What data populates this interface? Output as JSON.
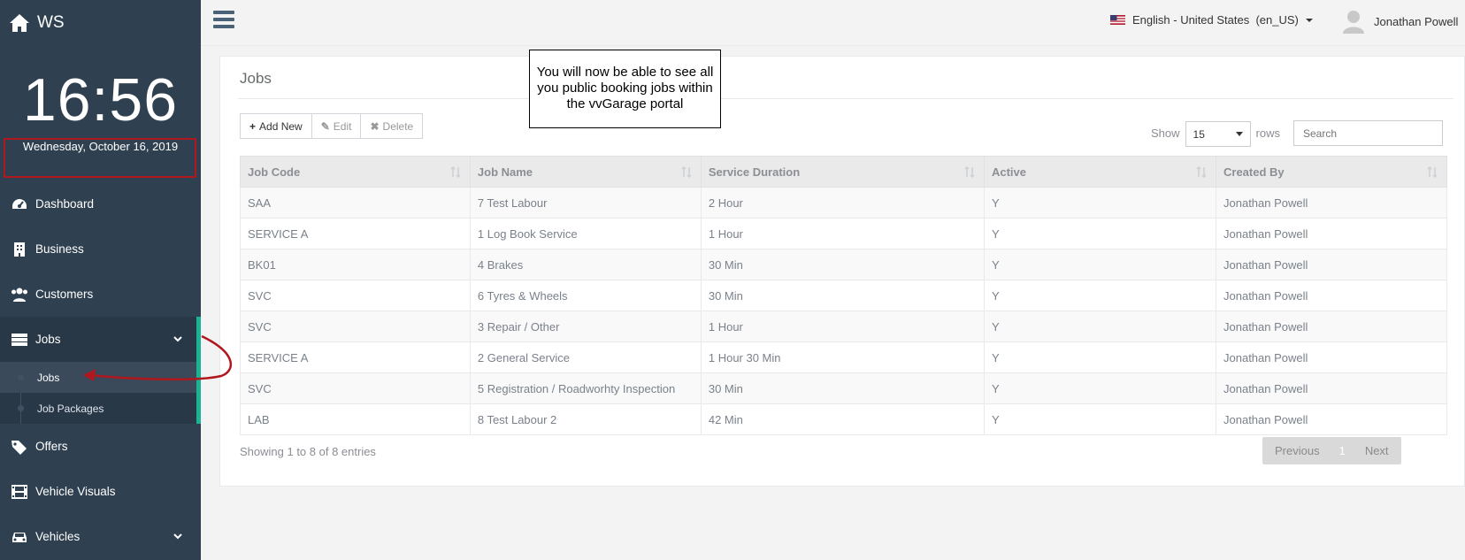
{
  "sidebar": {
    "brand": "WS",
    "clock": "16:56",
    "date": "Wednesday, October 16, 2019",
    "nav": {
      "dashboard": "Dashboard",
      "business": "Business",
      "customers": "Customers",
      "jobs": "Jobs",
      "jobs_sub": [
        "Jobs",
        "Job Packages"
      ],
      "offers": "Offers",
      "vehicle_visuals": "Vehicle Visuals",
      "vehicles": "Vehicles"
    }
  },
  "topbar": {
    "language": "English - United States  (en_US)",
    "user": "Jonathan Powell"
  },
  "panel": {
    "title": "Jobs",
    "buttons": {
      "add": "Add New",
      "edit": "Edit",
      "delete": "Delete"
    },
    "show_label": "Show",
    "rows_value": "15",
    "rows_label": "rows",
    "search_placeholder": "Search",
    "columns": [
      "Job Code",
      "Job Name",
      "Service Duration",
      "Active",
      "Created By"
    ],
    "rows": [
      [
        "SAA",
        "7 Test Labour",
        "2 Hour",
        "Y",
        "Jonathan Powell"
      ],
      [
        "SERVICE A",
        "1 Log Book Service",
        "1 Hour",
        "Y",
        "Jonathan Powell"
      ],
      [
        "BK01",
        "4 Brakes",
        "30 Min",
        "Y",
        "Jonathan Powell"
      ],
      [
        "SVC",
        "6 Tyres & Wheels",
        "30 Min",
        "Y",
        "Jonathan Powell"
      ],
      [
        "SVC",
        "3 Repair / Other",
        "1 Hour",
        "Y",
        "Jonathan Powell"
      ],
      [
        "SERVICE A",
        "2 General Service",
        "1 Hour 30 Min",
        "Y",
        "Jonathan Powell"
      ],
      [
        "SVC",
        "5 Registration / Roadworhty Inspection",
        "30 Min",
        "Y",
        "Jonathan Powell"
      ],
      [
        "LAB",
        "8 Test Labour 2",
        "42 Min",
        "Y",
        "Jonathan Powell"
      ]
    ],
    "entries": "Showing 1 to 8 of 8 entries",
    "pager": {
      "previous": "Previous",
      "current": "1",
      "next": "Next"
    }
  },
  "annotation": {
    "line1": "You will now be able to see all",
    "line2": "you public booking jobs within",
    "line3": "the vvGarage portal"
  },
  "colors": {
    "sidebar": "#2f4050",
    "accent": "#1ab394",
    "highlight": "#b0181e"
  }
}
